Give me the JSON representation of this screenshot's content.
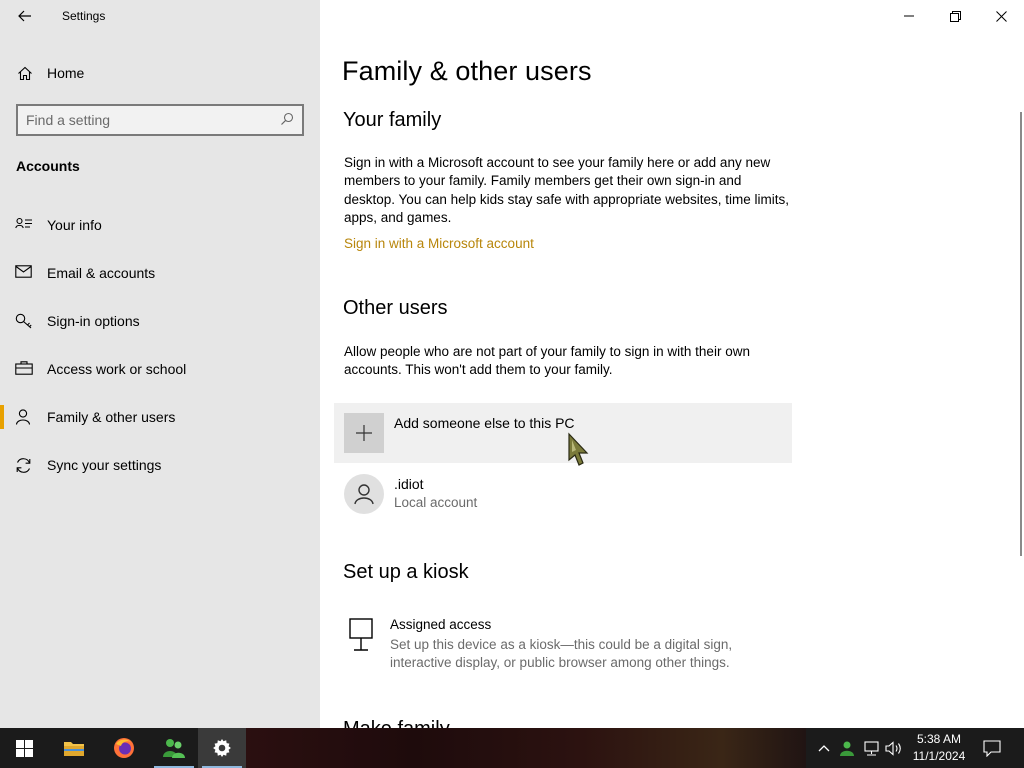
{
  "window": {
    "title": "Settings"
  },
  "sidebar": {
    "home_label": "Home",
    "search_placeholder": "Find a setting",
    "section_label": "Accounts",
    "items": [
      {
        "label": "Your info",
        "icon": "contact-card-icon"
      },
      {
        "label": "Email & accounts",
        "icon": "mail-icon"
      },
      {
        "label": "Sign-in options",
        "icon": "key-icon"
      },
      {
        "label": "Access work or school",
        "icon": "briefcase-icon"
      },
      {
        "label": "Family & other users",
        "icon": "person-icon",
        "active": true
      },
      {
        "label": "Sync your settings",
        "icon": "sync-icon"
      }
    ],
    "accent_color": "#e8a100"
  },
  "main": {
    "page_title": "Family & other users",
    "your_family": {
      "heading": "Your family",
      "description": "Sign in with a Microsoft account to see your family here or add any new members to your family. Family members get their own sign-in and desktop. You can help kids stay safe with appropriate websites, time limits, apps, and games.",
      "link": "Sign in with a Microsoft account"
    },
    "other_users": {
      "heading": "Other users",
      "description": "Allow people who are not part of your family to sign in with their own accounts. This won't add them to your family.",
      "add_label": "Add someone else to this PC",
      "users": [
        {
          "name": ".idiot",
          "type": "Local account"
        }
      ]
    },
    "kiosk": {
      "heading": "Set up a kiosk",
      "item_title": "Assigned access",
      "item_description": "Set up this device as a kiosk—this could be a digital sign, interactive display, or public browser among other things."
    },
    "next_heading_partial": "Make family ... ",
    "link_color": "#b8860b"
  },
  "taskbar": {
    "apps": [
      "start-icon",
      "file-explorer-icon",
      "firefox-icon",
      "users-app-icon",
      "settings-gear-icon"
    ],
    "clock": {
      "time": "5:38 AM",
      "date": "11/1/2024"
    }
  }
}
